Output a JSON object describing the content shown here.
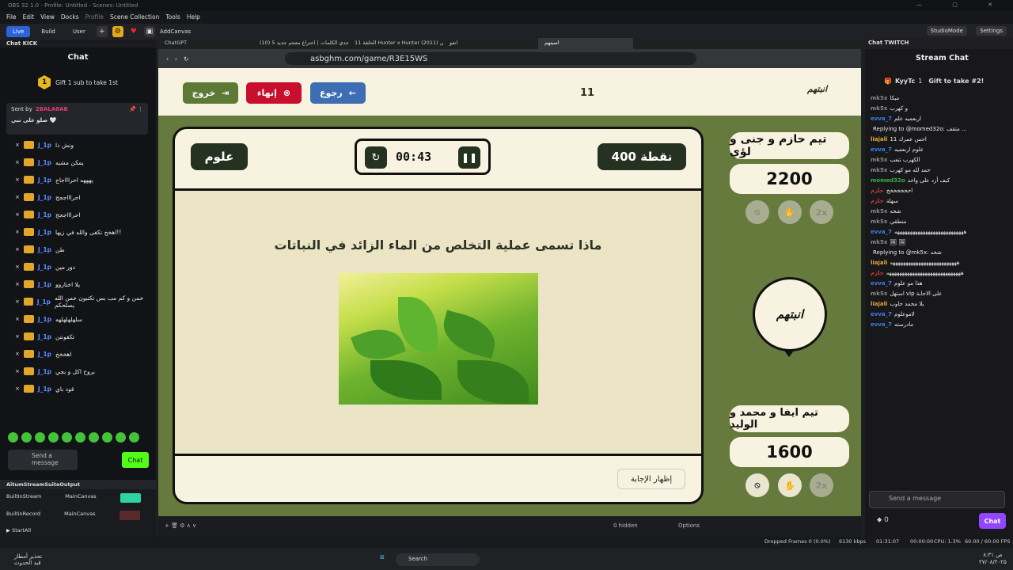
{
  "window": {
    "title": "OBS 32.1.0 - Profile: Untitled - Scenes: Untitled"
  },
  "menu": [
    "File",
    "Edit",
    "View",
    "Docks",
    "Profile",
    "Scene Collection",
    "Tools",
    "Help"
  ],
  "toolbar": {
    "live": "Live",
    "build": "Build",
    "user": "User",
    "add_canvas": "AddCanvas",
    "studio_mode": "StudioMode",
    "settings": "Settings"
  },
  "kick": {
    "dock_title": "Chat KICK",
    "title": "Chat",
    "gift_text": "Gift 1 sub to take 1st",
    "gift_count": "1",
    "pinned_sender_prefix": "Sent by",
    "pinned_sender": "2BALA8AB",
    "pinned_text": "صلو على نبي 🤍",
    "messages": [
      {
        "user": "J_1p",
        "text": "ونش ذا"
      },
      {
        "user": "J_1p",
        "text": "يمكن مشبه"
      },
      {
        "user": "J_1p",
        "text": "يهههه احراااجاج"
      },
      {
        "user": "J_1p",
        "text": "احراااججج"
      },
      {
        "user": "J_1p",
        "text": "احراااججج"
      },
      {
        "user": "J_1p",
        "text": "اهخخ تكفى والله في زيها!!"
      },
      {
        "user": "J_1p",
        "text": "طن"
      },
      {
        "user": "J_1p",
        "text": "دور مين"
      },
      {
        "user": "J_1p",
        "text": "يلا اختاروو"
      },
      {
        "user": "J_1p",
        "text": "خمن و كم مب بس تكتبون خمن الله يصلحكم"
      },
      {
        "user": "J_1p",
        "text": "سلهلهلهلهه"
      },
      {
        "user": "J_1p",
        "text": "تكفونتن"
      },
      {
        "user": "J_1p",
        "text": "اهخخخ"
      },
      {
        "user": "J_1p",
        "text": "بروح اكل و بجي"
      },
      {
        "user": "J_1p",
        "text": "قود باي"
      }
    ],
    "input_placeholder": "Send a message",
    "chat_button": "Chat"
  },
  "output_dock": {
    "title": "AitumStreamSuiteOutput",
    "rows": [
      {
        "name": "BuiltInStream",
        "canvas": "MainCanvas"
      },
      {
        "name": "BuiltinRecord",
        "canvas": "MainCanvas"
      }
    ],
    "start_all": "StartAll"
  },
  "browser": {
    "tabs": [
      "ChatGPT",
      "(10) تحدي الكلمات | اختراع معجم جديد 5",
      "الحلقة 11 Hunter x Hunter (2011) انمي",
      "انفو",
      "اسيتهم"
    ],
    "url": "asbghm.com/game/R3E15WS"
  },
  "game": {
    "logo": "انبتهم",
    "question_number": "11",
    "buttons": {
      "exit": "خروج",
      "end": "إنهاء",
      "back": "رجوع"
    },
    "topic": "علوم",
    "points": "400 نقطة",
    "timer": "00:43",
    "question": "ماذا تسمى عملية التخلص من الماء الزائد في النباتات",
    "show_answer": "إظهار الإجابة",
    "team1": {
      "name": "تيم حازم و جنى و لؤي",
      "score": "2200"
    },
    "team2": {
      "name": "تيم ايفا و محمد و الوليد",
      "score": "1600"
    },
    "lifeline_2x": "2x"
  },
  "obs_bottom": {
    "hidden": "0 hidden",
    "options": "Options"
  },
  "status": {
    "dropped": "Dropped Frames 0 (0.0%)",
    "kbps": "6130 kbps",
    "time": "01:31:07",
    "rec": "00:00:00",
    "cpu": "CPU: 1.3%",
    "fps": "60.00 / 60.00 FPS"
  },
  "taskbar": {
    "weather": "تحذير أمطار",
    "weather_sub": "قيد الحدوث",
    "search": "Search",
    "clock": "۸:۳۱ ص",
    "date": "۲۷/۰۸/۲۰۲۵"
  },
  "twitch": {
    "dock_title": "Chat TWITCH",
    "title": "Stream Chat",
    "gift_user": "KyyTc",
    "gift_count": "1",
    "gift_text": "Gift to take #2!",
    "messages": [
      {
        "user": "mk5x",
        "cls": "u-mk5x",
        "text": "ميكا"
      },
      {
        "user": "mk5x",
        "cls": "u-mk5x",
        "text": "و كهرب"
      },
      {
        "user": "evva_7",
        "cls": "u-evva",
        "text": "اربعميه علم"
      },
      {
        "user": "",
        "cls": "u-mk5x",
        "text": "Replying to @momed32o: متقف ..."
      },
      {
        "user": "liajali",
        "cls": "u-liajali",
        "text": "احس عمرك 11"
      },
      {
        "user": "evva_7",
        "cls": "u-evva",
        "text": "علوم اربعميه"
      },
      {
        "user": "mk5x",
        "cls": "u-mk5x",
        "text": "الكهرب تتعب"
      },
      {
        "user": "mk5x",
        "cls": "u-mk5x",
        "text": "حمد لله مو كهرب"
      },
      {
        "user": "momed32o",
        "cls": "u-momed",
        "text": "كيف أرد على واحد"
      },
      {
        "user": "حازم",
        "cls": "u-red",
        "text": "اخخخخخخخ"
      },
      {
        "user": "حازم",
        "cls": "u-red",
        "text": "سهلة"
      },
      {
        "user": "mk5x",
        "cls": "u-mk5x",
        "text": "شخه"
      },
      {
        "user": "mk5x",
        "cls": "u-mk5x",
        "text": "منطقي"
      },
      {
        "user": "evva_7",
        "cls": "u-evva",
        "text": "هههههههههههههههههههههههههههه"
      },
      {
        "user": "mk5x",
        "cls": "u-mk5x",
        "text": "🖼 🖼"
      },
      {
        "user": "",
        "cls": "u-mk5x",
        "text": "Replying to @mk5x: شخه"
      },
      {
        "user": "liajali",
        "cls": "u-liajali",
        "text": "ههههههههههههههههههههههههههه"
      },
      {
        "user": "حازم",
        "cls": "u-red",
        "text": "هههههههههههههههههههههههههههههه"
      },
      {
        "user": "evva_7",
        "cls": "u-evva",
        "text": "هذا مو علوم"
      },
      {
        "user": "mk5x",
        "cls": "u-mk5x",
        "text": "استهل vip على الاجابة"
      },
      {
        "user": "liajali",
        "cls": "u-liajali",
        "text": "يلا محمد جاوب"
      },
      {
        "user": "evva_7",
        "cls": "u-evva",
        "text": "لاموعلوم"
      },
      {
        "user": "evva_7",
        "cls": "u-evva",
        "text": "مادرسته"
      }
    ],
    "input_placeholder": "Send a message",
    "points": "0",
    "chat_button": "Chat"
  }
}
